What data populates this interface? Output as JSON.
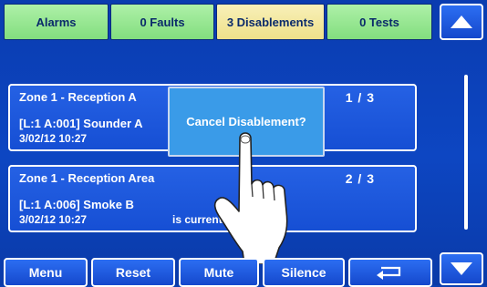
{
  "tabs": [
    {
      "label": "Alarms"
    },
    {
      "label": "0 Faults"
    },
    {
      "label": "3 Disablements"
    },
    {
      "label": "0 Tests"
    }
  ],
  "events": [
    {
      "zone": "Zone  1 - Reception A",
      "counter": "1 /  3",
      "device": "[L:1 A:001] Sounder A",
      "timestamp": "3/02/12 10:27",
      "status": ""
    },
    {
      "zone": "Zone  1 - Reception Area",
      "counter": "2 /  3",
      "device": "[L:1 A:006] Smoke B",
      "timestamp": "3/02/12 10:27",
      "status": "is currently DIS     ED"
    }
  ],
  "popup": {
    "label": "Cancel Disablement?"
  },
  "bottom_buttons": [
    {
      "label": "Menu"
    },
    {
      "label": "Reset"
    },
    {
      "label": "Mute"
    },
    {
      "label": "Silence"
    }
  ],
  "icons": {
    "scroll_up": "triangle-up-icon",
    "scroll_down": "triangle-down-icon",
    "return": "return-arrow-icon",
    "hand": "pointing-hand-icon"
  },
  "colors": {
    "background": "#0b3fb0",
    "tab_green": "#82de7e",
    "tab_yellow": "#eee08a",
    "popup": "#3a9be8"
  }
}
